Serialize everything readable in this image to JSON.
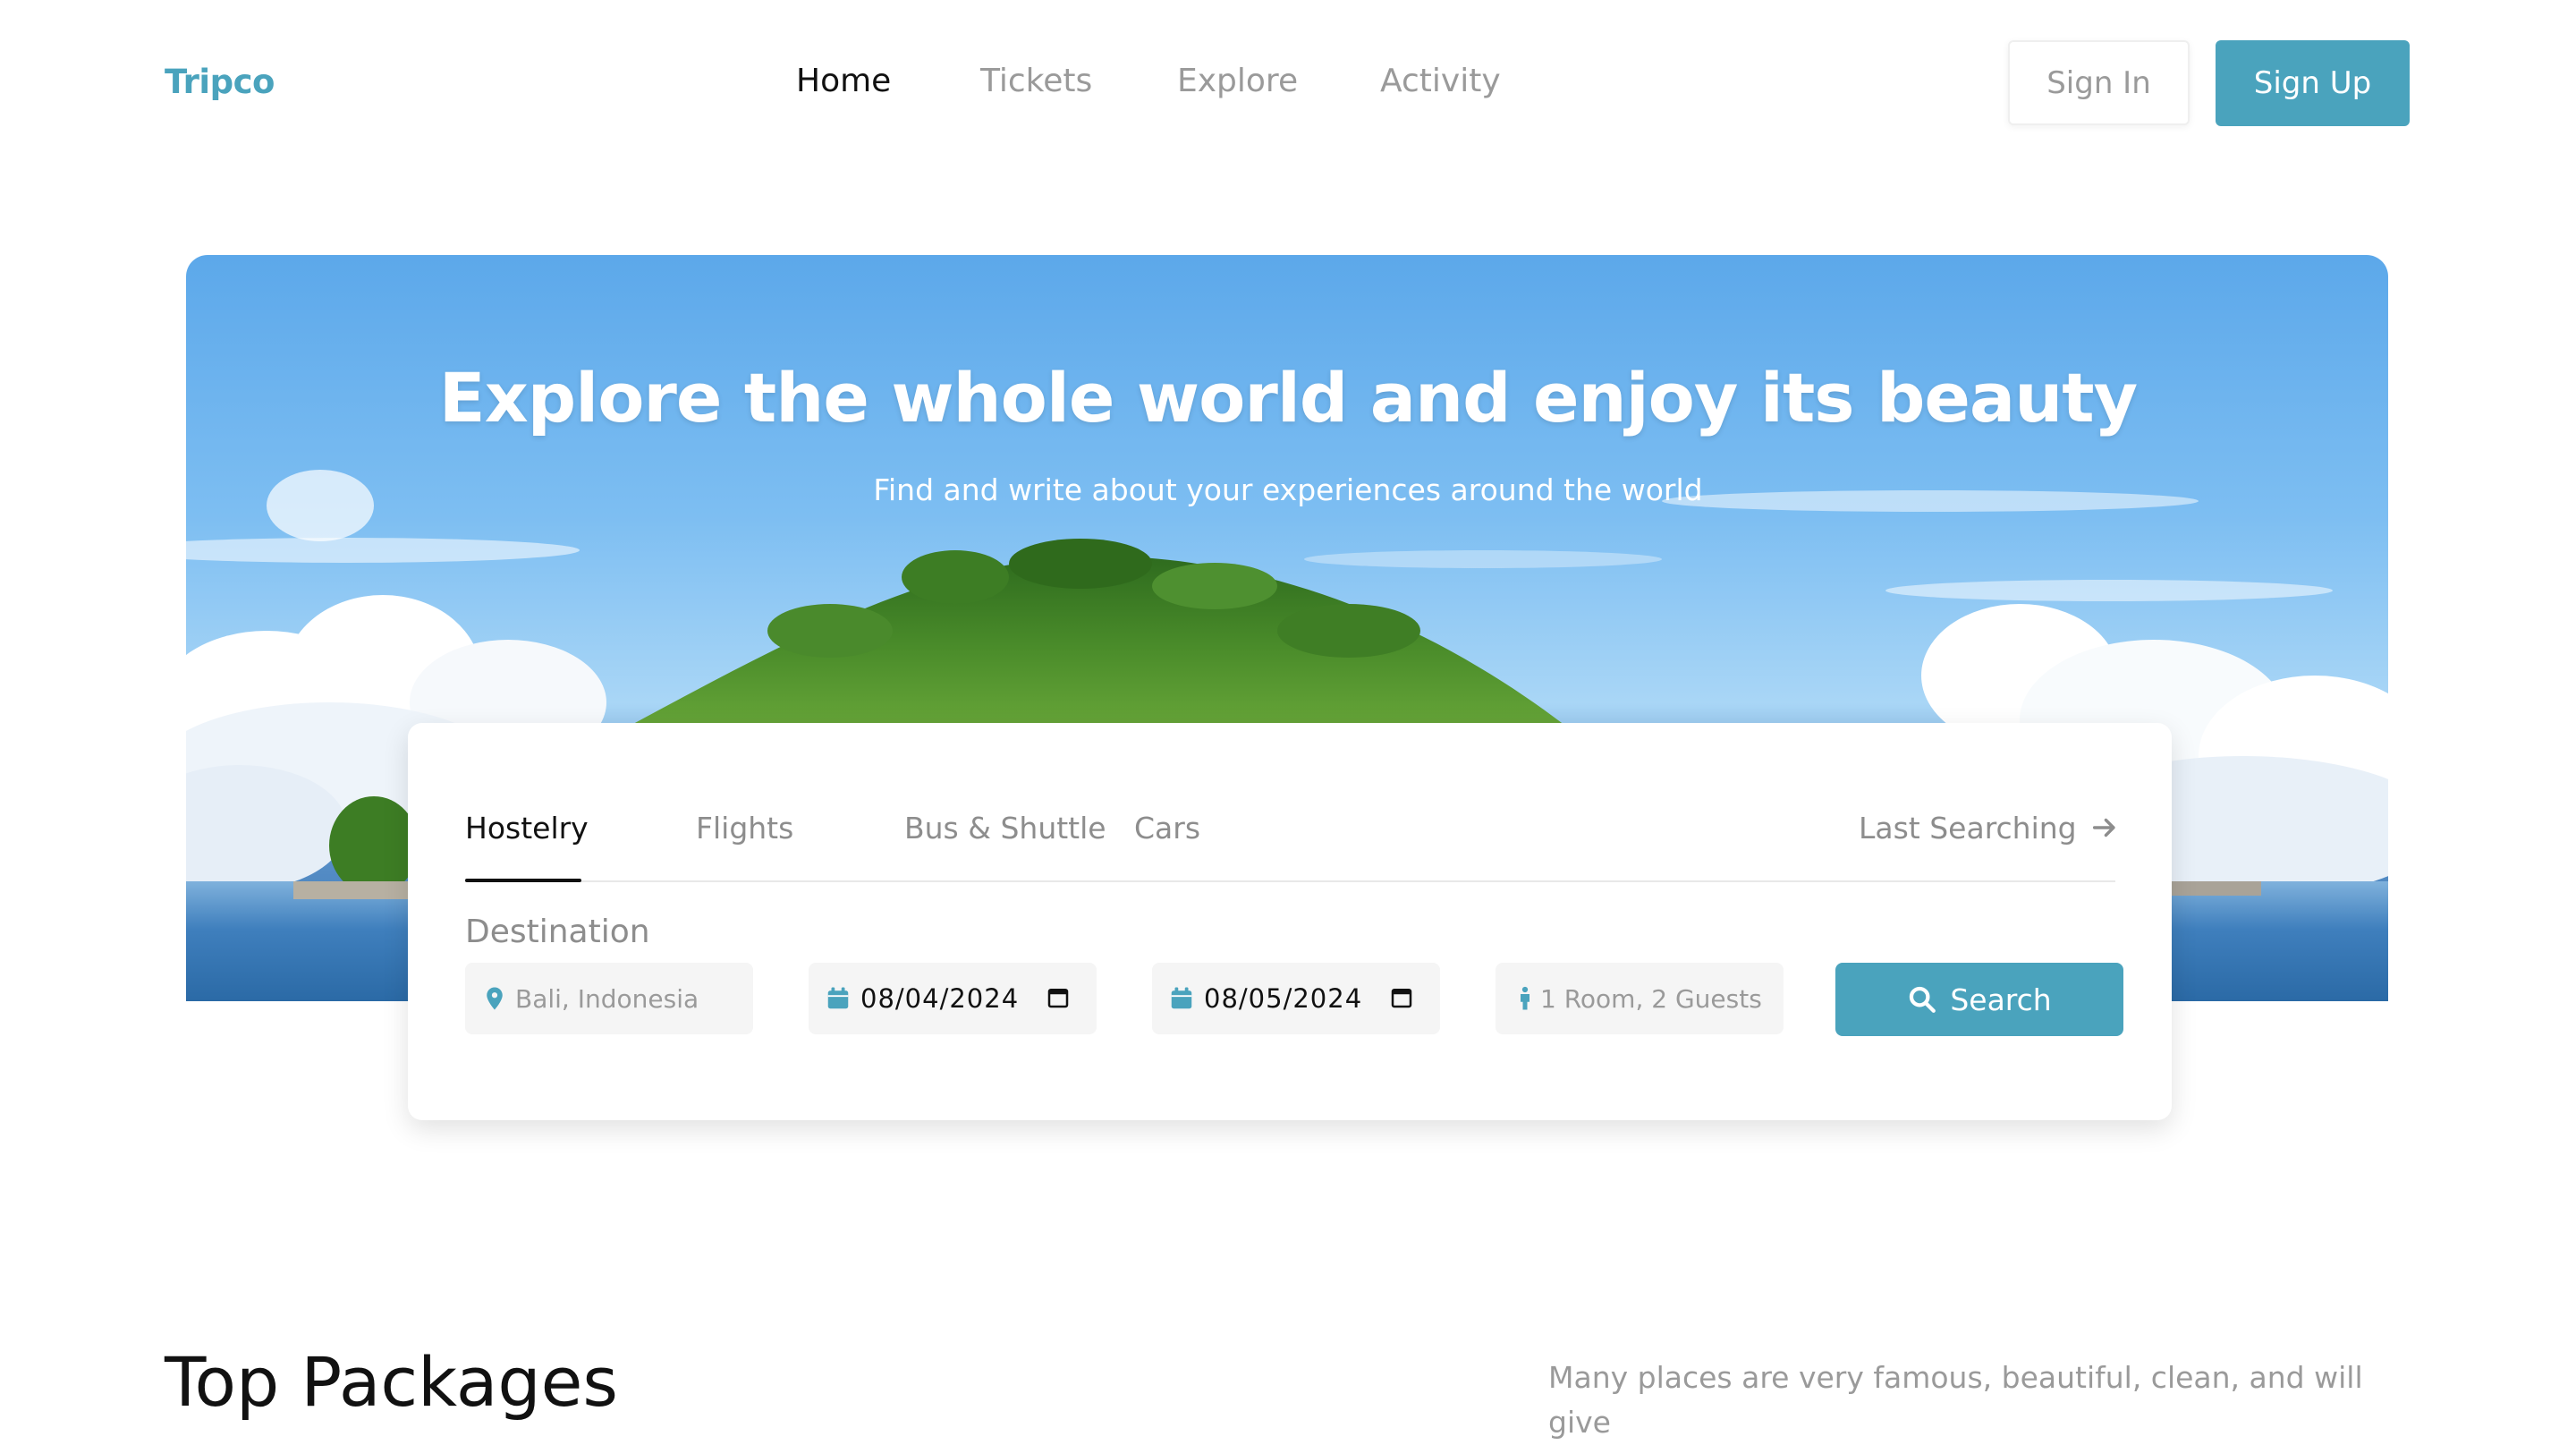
{
  "header": {
    "logo": "Tripco",
    "nav": [
      "Home",
      "Tickets",
      "Explore",
      "Activity"
    ],
    "active_nav": "Home",
    "sign_in": "Sign In",
    "sign_up": "Sign Up"
  },
  "hero": {
    "title": "Explore the whole world and enjoy its beauty",
    "subtitle": "Find and write about your experiences around the world"
  },
  "search_card": {
    "tabs": [
      "Hostelry",
      "Flights",
      "Bus & Shuttle",
      "Cars"
    ],
    "active_tab": "Hostelry",
    "last_searching": "Last Searching",
    "destination_label": "Destination",
    "destination_value": "Bali, Indonesia",
    "check_in": "08/04/2024",
    "check_out": "08/05/2024",
    "guests": "1 Room, 2 Guests",
    "search_button": "Search"
  },
  "packages": {
    "title": "Top Packages",
    "description": "Many places are very famous, beautiful, clean, and will give"
  },
  "colors": {
    "accent": "#4aa3bd",
    "text_muted": "#9a9a9a",
    "text_dark": "#111111"
  }
}
